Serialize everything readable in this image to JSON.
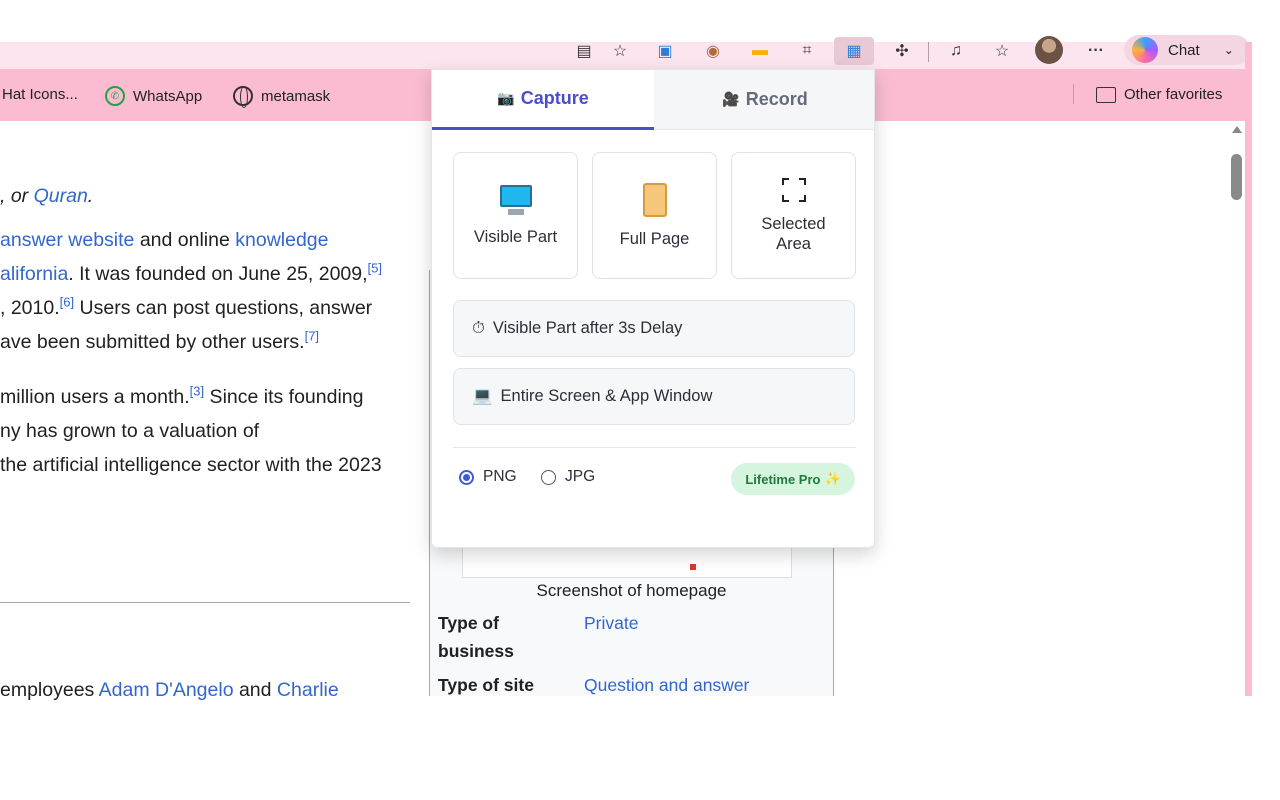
{
  "browser": {
    "chat_label": "Chat",
    "bookmarks": [
      "Hat Icons...",
      "WhatsApp",
      "metamask"
    ],
    "other_favorites": "Other favorites"
  },
  "article": {
    "line1_pre": ", or ",
    "line1_link": "Quran",
    "line1_post": ".",
    "line2_link1": "answer website",
    "line2_mid": " and online ",
    "line2_link2": "knowledge",
    "line3_link": "alifornia",
    "line3_text": ". It was founded on June 25, 2009,",
    "line3_ref": "[5]",
    "line4_pre": ", 2010.",
    "line4_ref": "[6]",
    "line4_text": " Users can post questions, answer",
    "line5_text": "ave been submitted by other users.",
    "line5_ref": "[7]",
    "line6_pre": "million users a month.",
    "line6_ref": "[3]",
    "line6_text": " Since its founding",
    "line7_text": "ny has grown to a valuation of",
    "line8_text": "the artificial intelligence sector with the 2023",
    "line9_pre": " employees ",
    "line9_link1": "Adam D'Angelo",
    "line9_mid": " and ",
    "line9_link2": "Charlie"
  },
  "infobox": {
    "caption": "Screenshot of homepage",
    "rows": [
      {
        "label_1": "Type of",
        "label_2": "business",
        "value": "Private"
      },
      {
        "label": "Type of site",
        "value": "Question and answer"
      }
    ]
  },
  "popup": {
    "tabs": {
      "capture": "Capture",
      "record": "Record"
    },
    "cards": [
      "Visible Part",
      "Full Page",
      "Selected\nArea"
    ],
    "card_selected_line1": "Selected",
    "card_selected_line2": "Area",
    "delay_button": "Visible Part after 3s Delay",
    "screen_button": "Entire Screen & App Window",
    "formats": {
      "png": "PNG",
      "jpg": "JPG",
      "selected": "PNG"
    },
    "pro_badge": "Lifetime Pro",
    "icons": {
      "capture": "camera-icon",
      "record": "video-camera-icon",
      "visible": "monitor-icon",
      "full": "scroll-icon",
      "selected": "crop-frame-icon",
      "delay": "stopwatch-icon",
      "screen": "laptop-icon",
      "pro": "sparkles-icon"
    }
  },
  "colors": {
    "accent": "#4a4fc7",
    "link": "#3366cc",
    "bookmark_bar": "#fbbcd2",
    "pro_bg": "#d6f5df"
  }
}
